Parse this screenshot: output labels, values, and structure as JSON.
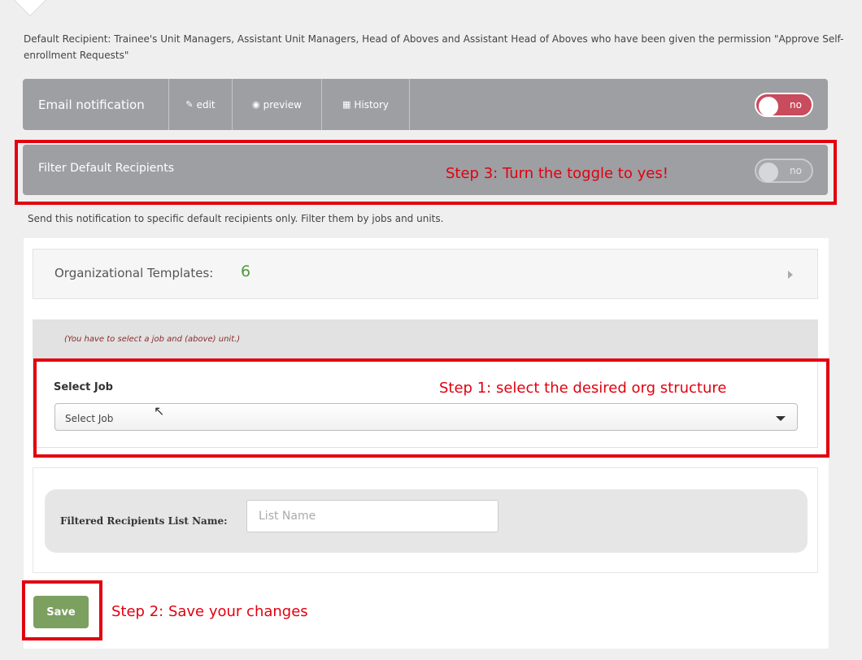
{
  "description": "Default Recipient: Trainee's Unit Managers, Assistant Unit Managers, Head of Aboves and Assistant Head of Aboves who have been given the permission \"Approve Self-enrollment Requests\"",
  "email_bar": {
    "title": "Email notification",
    "tabs": {
      "edit": "edit",
      "preview": "preview",
      "history": "History"
    },
    "toggle_label": "no"
  },
  "filter_bar": {
    "title": "Filter Default Recipients",
    "toggle_label": "no"
  },
  "send_text": "Send this notification to specific default recipients only. Filter them by jobs and units.",
  "org_templates": {
    "label": "Organizational Templates:",
    "count": "6"
  },
  "job": {
    "hint": "(You have to select a job and (above) unit.)",
    "label": "Select Job",
    "select_value": "Select Job"
  },
  "list_name": {
    "label": "Filtered Recipients List Name:",
    "placeholder": "List Name"
  },
  "save_label": "Save",
  "annotations": {
    "step1": "Step 1: select the desired org structure",
    "step2": "Step 2: Save your changes",
    "step3": "Step 3: Turn the toggle to yes!"
  },
  "colors": {
    "bar": "#9d9fa3",
    "toggle_on": "#c94b5e",
    "save": "#7ba05f",
    "annotation": "#e2000f",
    "count": "#4f9a3c"
  }
}
